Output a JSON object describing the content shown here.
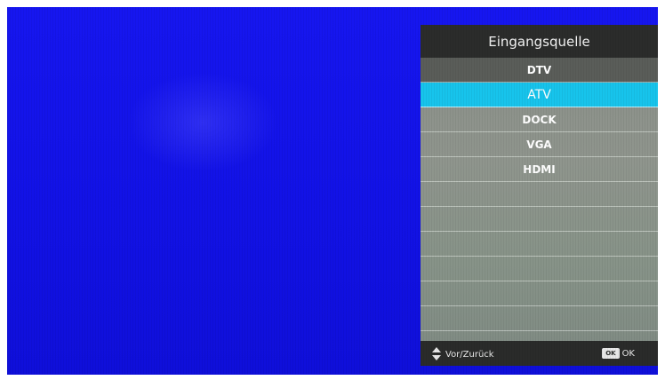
{
  "menu": {
    "title": "Eingangsquelle",
    "items": [
      {
        "label": "DTV"
      },
      {
        "label": "ATV"
      },
      {
        "label": "DOCK"
      },
      {
        "label": "VGA"
      },
      {
        "label": "HDMI"
      },
      {
        "label": ""
      },
      {
        "label": ""
      },
      {
        "label": ""
      },
      {
        "label": ""
      },
      {
        "label": ""
      },
      {
        "label": ""
      }
    ],
    "selected_index": 1
  },
  "footer": {
    "nav_hint": "Vor/Zurück",
    "ok_key": "OK",
    "ok_label": "OK",
    "nav_icon": "updown-arrows-icon"
  },
  "colors": {
    "background": "#1414ec",
    "highlight": "#17c4ec",
    "header": "#2b2c2b"
  }
}
